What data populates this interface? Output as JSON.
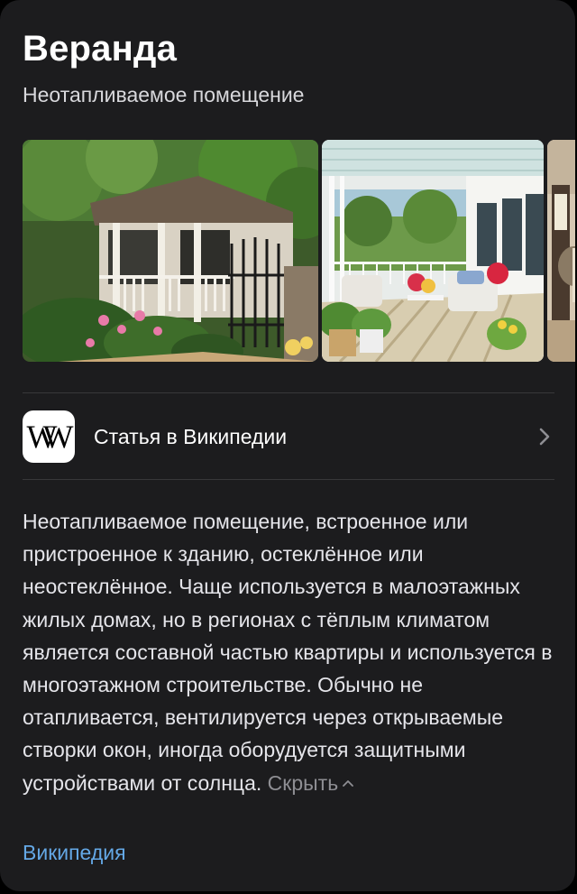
{
  "header": {
    "title": "Веранда",
    "subtitle": "Неотапливаемое помещение"
  },
  "gallery": {
    "images": [
      {
        "name": "veranda-house-garden-photo"
      },
      {
        "name": "porch-white-furniture-photo"
      },
      {
        "name": "porch-partial-photo"
      }
    ]
  },
  "wiki_row": {
    "logo_letter": "W",
    "label": "Статья в Википедии",
    "icon": "chevron-right-icon"
  },
  "description": {
    "text": "Неотапливаемое помещение, встроенное или пристроенное к зданию, остеклённое или неостеклённое. Чаще используется в малоэтажных жилых домах, но в регионах с тёплым климатом является составной частью квартиры и используется в многоэтажном строительстве. Обычно не отапливается, вентилируется через открываемые створки окон, иногда оборудуется защитными устройствами от солнца.",
    "hide_label": "Скрыть"
  },
  "source": {
    "label": "Википедия"
  },
  "colors": {
    "background": "#000000",
    "card": "#1c1c1e",
    "divider": "#38383a",
    "link": "#64a8e6",
    "muted": "#8e8e93"
  }
}
